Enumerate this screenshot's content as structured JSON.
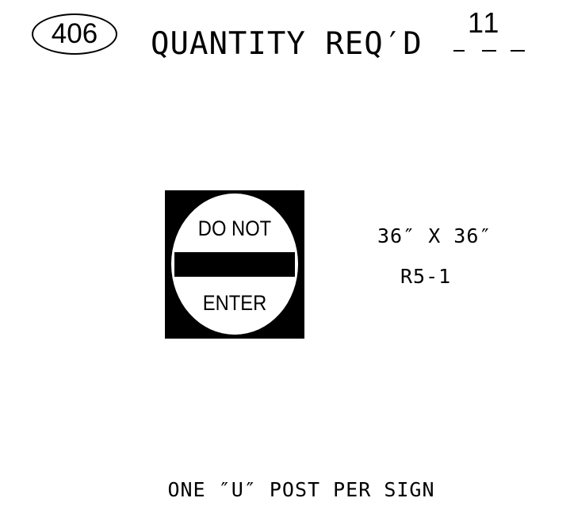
{
  "header": {
    "sheet_number": "406",
    "quantity_label": "QUANTITY REQ′D",
    "quantity_value": "11"
  },
  "sign": {
    "icon": "do-not-enter-sign",
    "text_top": "DO NOT",
    "text_bottom": "ENTER",
    "size": "36″ X 36″",
    "code": "R5-1"
  },
  "footer": {
    "post_note": "ONE ″U″ POST PER SIGN"
  },
  "colors": {
    "ink": "#000000",
    "background": "#ffffff"
  }
}
